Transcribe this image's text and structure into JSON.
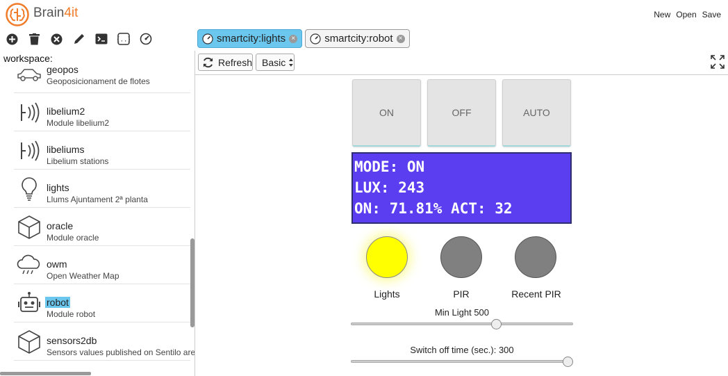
{
  "app": {
    "brand_prefix": "Brain",
    "brand_suffix": "4it"
  },
  "top_menu": {
    "new": "New",
    "open": "Open",
    "save": "Save"
  },
  "toolbar": [
    "add-icon",
    "delete-icon",
    "close-icon",
    "edit-icon",
    "terminal-icon",
    "code-icon",
    "dashboard-icon"
  ],
  "tabs": [
    {
      "label": "smartcity:lights",
      "active": true
    },
    {
      "label": "smartcity:robot",
      "active": false
    }
  ],
  "sidebar": {
    "workspace_label": "workspace:",
    "modules": [
      {
        "name": "geopos",
        "desc": "Geoposicionament de flotes",
        "icon": "car-icon"
      },
      {
        "name": "libelium2",
        "desc": "Module libelium2",
        "icon": "signal-icon"
      },
      {
        "name": "libeliums",
        "desc": "Libelium stations",
        "icon": "signal-icon"
      },
      {
        "name": "lights",
        "desc": "Llums Ajuntament 2ª planta",
        "icon": "lightbulb-icon"
      },
      {
        "name": "oracle",
        "desc": "Module oracle",
        "icon": "cube-icon"
      },
      {
        "name": "owm",
        "desc": "Open Weather Map",
        "icon": "cloud-rain-icon"
      },
      {
        "name": "robot",
        "desc": "Module robot",
        "icon": "robot-icon",
        "selected": true
      },
      {
        "name": "sensors2db",
        "desc": "Sensors values published on Sentilo are st",
        "icon": "cube-icon"
      }
    ]
  },
  "panel": {
    "refresh_label": "Refresh",
    "view_select": "Basic",
    "buttons": {
      "on": "ON",
      "off": "OFF",
      "auto": "AUTO"
    },
    "display": {
      "line1": "MODE: ON",
      "line2": "LUX: 243",
      "line3": "ON: 71.81% ACT: 32",
      "background": "#5a3ef0"
    },
    "indicators": [
      {
        "label": "Lights",
        "state": "on",
        "color": "#ffff00"
      },
      {
        "label": "PIR",
        "state": "off",
        "color": "#808080"
      },
      {
        "label": "Recent PIR",
        "state": "off",
        "color": "#808080"
      }
    ],
    "min_light": {
      "label": "Min Light 500",
      "value": 500
    },
    "switch_off": {
      "label": "Switch off time (sec.): 300",
      "value": 300
    }
  }
}
